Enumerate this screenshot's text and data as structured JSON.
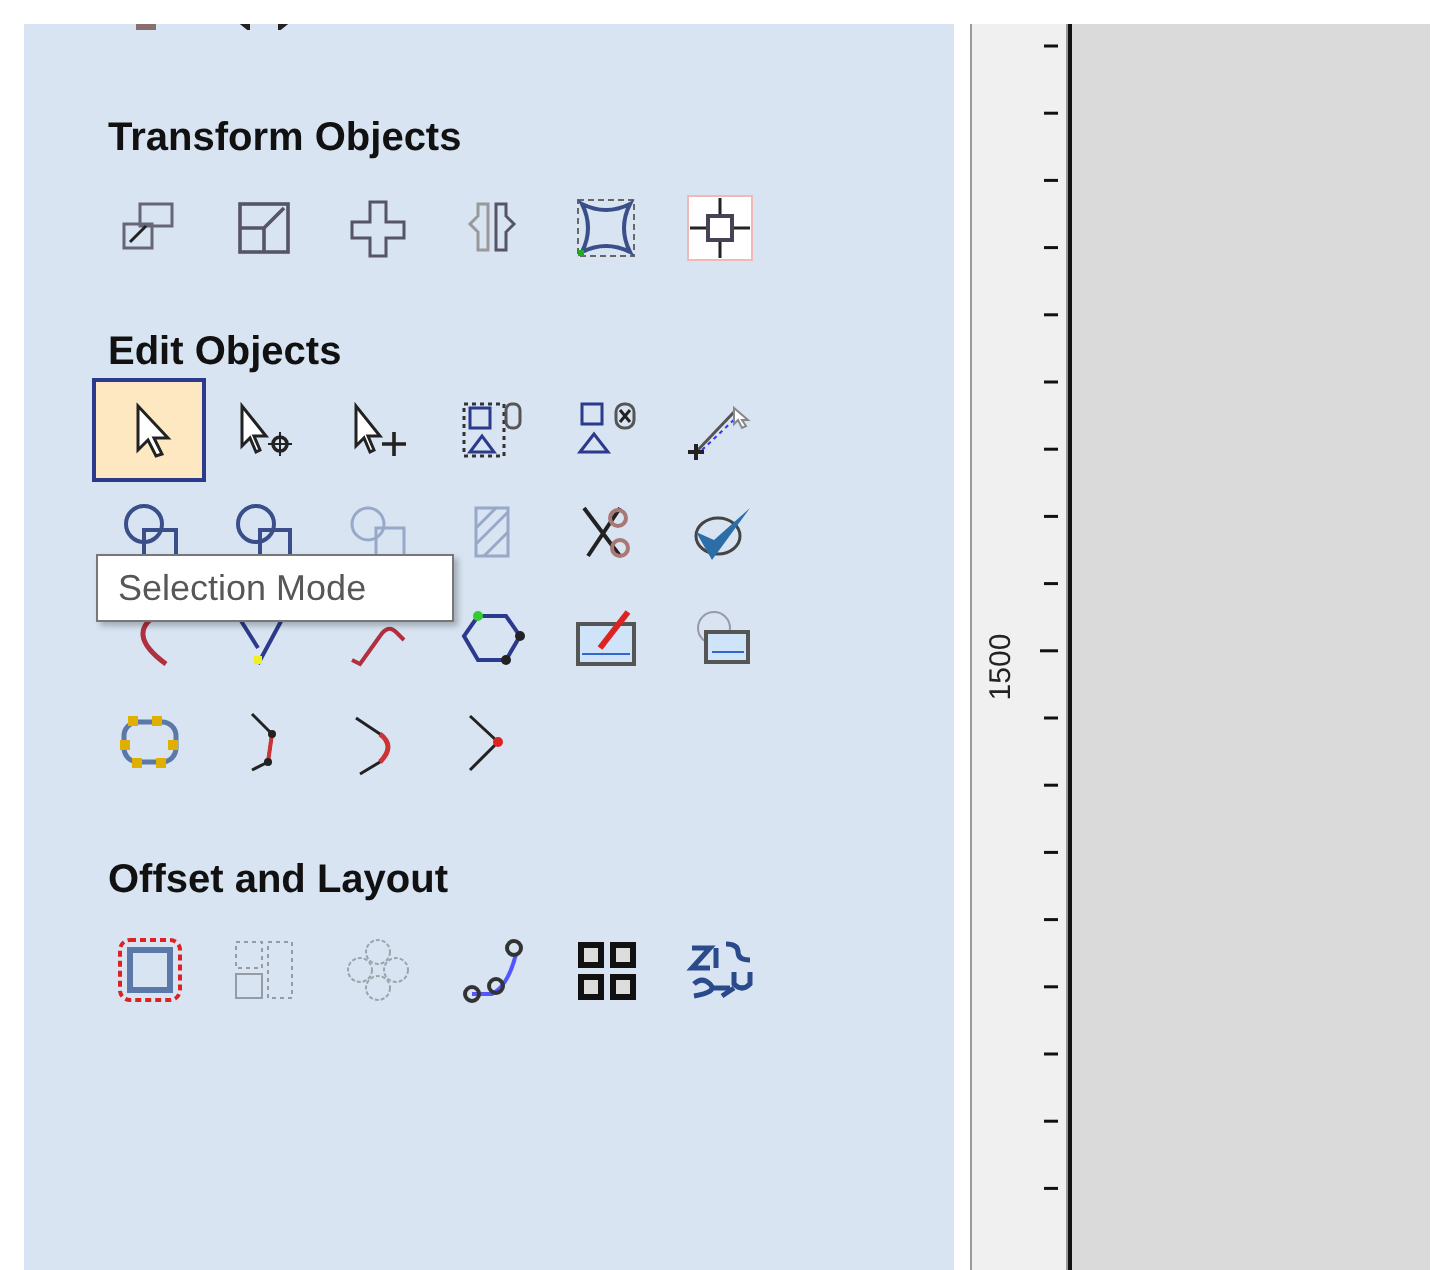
{
  "top_tools": [
    {
      "selected": false,
      "disabled": false
    },
    {
      "selected": false,
      "disabled": false
    }
  ],
  "sections": [
    {
      "title": "Transform Objects",
      "rows": [
        [
          {
            "selected": false,
            "disabled": false
          },
          {
            "selected": false,
            "disabled": false
          },
          {
            "selected": false,
            "disabled": false
          },
          {
            "selected": false,
            "disabled": false
          },
          {
            "selected": false,
            "disabled": false
          },
          {
            "selected": false,
            "disabled": false
          }
        ]
      ]
    },
    {
      "title": "Edit Objects",
      "rows": [
        [
          {
            "selected": true,
            "disabled": false
          },
          {
            "selected": false,
            "disabled": false
          },
          {
            "selected": false,
            "disabled": false
          },
          {
            "selected": false,
            "disabled": false
          },
          {
            "selected": false,
            "disabled": false
          },
          {
            "selected": false,
            "disabled": false
          }
        ],
        [
          {
            "selected": false,
            "disabled": false
          },
          {
            "selected": false,
            "disabled": false
          },
          {
            "selected": false,
            "disabled": true
          },
          {
            "selected": false,
            "disabled": true
          },
          {
            "selected": false,
            "disabled": false
          },
          {
            "selected": false,
            "disabled": false
          }
        ],
        [
          {
            "selected": false,
            "disabled": false
          },
          {
            "selected": false,
            "disabled": false
          },
          {
            "selected": false,
            "disabled": false
          },
          {
            "selected": false,
            "disabled": false
          },
          {
            "selected": false,
            "disabled": false
          },
          {
            "selected": false,
            "disabled": false
          }
        ],
        [
          {
            "selected": false,
            "disabled": false
          },
          {
            "selected": false,
            "disabled": false
          },
          {
            "selected": false,
            "disabled": false
          },
          {
            "selected": false,
            "disabled": false
          }
        ]
      ]
    },
    {
      "title": "Offset and Layout",
      "rows": [
        [
          {
            "selected": false,
            "disabled": false
          },
          {
            "selected": false,
            "disabled": true
          },
          {
            "selected": false,
            "disabled": true
          },
          {
            "selected": false,
            "disabled": false
          },
          {
            "selected": false,
            "disabled": false
          },
          {
            "selected": false,
            "disabled": false
          }
        ]
      ]
    }
  ],
  "tooltip": {
    "text": "Selection Mode"
  },
  "ruler": {
    "label": "1500"
  }
}
